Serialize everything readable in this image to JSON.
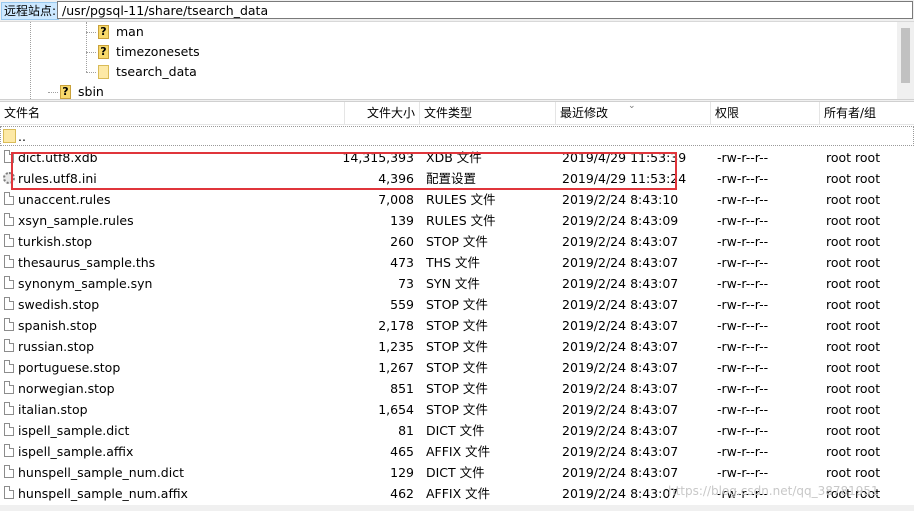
{
  "path_bar": {
    "label": "远程站点:",
    "path": "/usr/pgsql-11/share/tsearch_data"
  },
  "tree": {
    "items": [
      {
        "label": "man",
        "icon": "question-folder-icon"
      },
      {
        "label": "timezonesets",
        "icon": "question-folder-icon"
      },
      {
        "label": "tsearch_data",
        "icon": "folder-icon"
      },
      {
        "label": "sbin",
        "icon": "question-folder-icon"
      }
    ]
  },
  "columns": {
    "name": "文件名",
    "size": "文件大小",
    "type": "文件类型",
    "modified": "最近修改",
    "perm": "权限",
    "owner": "所有者/组"
  },
  "parent_dir": "..",
  "files": [
    {
      "name": "dict.utf8.xdb",
      "size": "14,315,393",
      "type": "XDB 文件",
      "modified": "2019/4/29 11:53:39",
      "perm": "-rw-r--r--",
      "owner": "root root"
    },
    {
      "name": "rules.utf8.ini",
      "size": "4,396",
      "type": "配置设置",
      "modified": "2019/4/29 11:53:24",
      "perm": "-rw-r--r--",
      "owner": "root root"
    },
    {
      "name": "unaccent.rules",
      "size": "7,008",
      "type": "RULES 文件",
      "modified": "2019/2/24 8:43:10",
      "perm": "-rw-r--r--",
      "owner": "root root"
    },
    {
      "name": "xsyn_sample.rules",
      "size": "139",
      "type": "RULES 文件",
      "modified": "2019/2/24 8:43:09",
      "perm": "-rw-r--r--",
      "owner": "root root"
    },
    {
      "name": "turkish.stop",
      "size": "260",
      "type": "STOP 文件",
      "modified": "2019/2/24 8:43:07",
      "perm": "-rw-r--r--",
      "owner": "root root"
    },
    {
      "name": "thesaurus_sample.ths",
      "size": "473",
      "type": "THS 文件",
      "modified": "2019/2/24 8:43:07",
      "perm": "-rw-r--r--",
      "owner": "root root"
    },
    {
      "name": "synonym_sample.syn",
      "size": "73",
      "type": "SYN 文件",
      "modified": "2019/2/24 8:43:07",
      "perm": "-rw-r--r--",
      "owner": "root root"
    },
    {
      "name": "swedish.stop",
      "size": "559",
      "type": "STOP 文件",
      "modified": "2019/2/24 8:43:07",
      "perm": "-rw-r--r--",
      "owner": "root root"
    },
    {
      "name": "spanish.stop",
      "size": "2,178",
      "type": "STOP 文件",
      "modified": "2019/2/24 8:43:07",
      "perm": "-rw-r--r--",
      "owner": "root root"
    },
    {
      "name": "russian.stop",
      "size": "1,235",
      "type": "STOP 文件",
      "modified": "2019/2/24 8:43:07",
      "perm": "-rw-r--r--",
      "owner": "root root"
    },
    {
      "name": "portuguese.stop",
      "size": "1,267",
      "type": "STOP 文件",
      "modified": "2019/2/24 8:43:07",
      "perm": "-rw-r--r--",
      "owner": "root root"
    },
    {
      "name": "norwegian.stop",
      "size": "851",
      "type": "STOP 文件",
      "modified": "2019/2/24 8:43:07",
      "perm": "-rw-r--r--",
      "owner": "root root"
    },
    {
      "name": "italian.stop",
      "size": "1,654",
      "type": "STOP 文件",
      "modified": "2019/2/24 8:43:07",
      "perm": "-rw-r--r--",
      "owner": "root root"
    },
    {
      "name": "ispell_sample.dict",
      "size": "81",
      "type": "DICT 文件",
      "modified": "2019/2/24 8:43:07",
      "perm": "-rw-r--r--",
      "owner": "root root"
    },
    {
      "name": "ispell_sample.affix",
      "size": "465",
      "type": "AFFIX 文件",
      "modified": "2019/2/24 8:43:07",
      "perm": "-rw-r--r--",
      "owner": "root root"
    },
    {
      "name": "hunspell_sample_num.dict",
      "size": "129",
      "type": "DICT 文件",
      "modified": "2019/2/24 8:43:07",
      "perm": "-rw-r--r--",
      "owner": "root root"
    },
    {
      "name": "hunspell_sample_num.affix",
      "size": "462",
      "type": "AFFIX 文件",
      "modified": "2019/2/24 8:43:07",
      "perm": "-rw-r--r--",
      "owner": "root root"
    }
  ],
  "watermark": "https://blog.csdn.net/qq_38781951",
  "colors": {
    "highlight": "#e0353b",
    "path_label_bg": "#cce8ff"
  }
}
